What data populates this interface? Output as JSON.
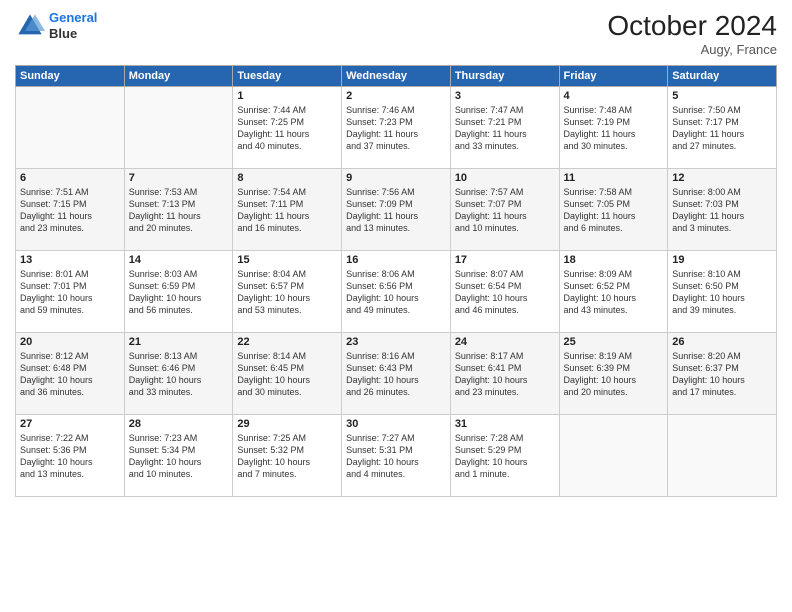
{
  "logo": {
    "line1": "General",
    "line2": "Blue"
  },
  "header": {
    "month": "October 2024",
    "location": "Augy, France"
  },
  "weekdays": [
    "Sunday",
    "Monday",
    "Tuesday",
    "Wednesday",
    "Thursday",
    "Friday",
    "Saturday"
  ],
  "weeks": [
    [
      {
        "day": "",
        "info": ""
      },
      {
        "day": "",
        "info": ""
      },
      {
        "day": "1",
        "info": "Sunrise: 7:44 AM\nSunset: 7:25 PM\nDaylight: 11 hours\nand 40 minutes."
      },
      {
        "day": "2",
        "info": "Sunrise: 7:46 AM\nSunset: 7:23 PM\nDaylight: 11 hours\nand 37 minutes."
      },
      {
        "day": "3",
        "info": "Sunrise: 7:47 AM\nSunset: 7:21 PM\nDaylight: 11 hours\nand 33 minutes."
      },
      {
        "day": "4",
        "info": "Sunrise: 7:48 AM\nSunset: 7:19 PM\nDaylight: 11 hours\nand 30 minutes."
      },
      {
        "day": "5",
        "info": "Sunrise: 7:50 AM\nSunset: 7:17 PM\nDaylight: 11 hours\nand 27 minutes."
      }
    ],
    [
      {
        "day": "6",
        "info": "Sunrise: 7:51 AM\nSunset: 7:15 PM\nDaylight: 11 hours\nand 23 minutes."
      },
      {
        "day": "7",
        "info": "Sunrise: 7:53 AM\nSunset: 7:13 PM\nDaylight: 11 hours\nand 20 minutes."
      },
      {
        "day": "8",
        "info": "Sunrise: 7:54 AM\nSunset: 7:11 PM\nDaylight: 11 hours\nand 16 minutes."
      },
      {
        "day": "9",
        "info": "Sunrise: 7:56 AM\nSunset: 7:09 PM\nDaylight: 11 hours\nand 13 minutes."
      },
      {
        "day": "10",
        "info": "Sunrise: 7:57 AM\nSunset: 7:07 PM\nDaylight: 11 hours\nand 10 minutes."
      },
      {
        "day": "11",
        "info": "Sunrise: 7:58 AM\nSunset: 7:05 PM\nDaylight: 11 hours\nand 6 minutes."
      },
      {
        "day": "12",
        "info": "Sunrise: 8:00 AM\nSunset: 7:03 PM\nDaylight: 11 hours\nand 3 minutes."
      }
    ],
    [
      {
        "day": "13",
        "info": "Sunrise: 8:01 AM\nSunset: 7:01 PM\nDaylight: 10 hours\nand 59 minutes."
      },
      {
        "day": "14",
        "info": "Sunrise: 8:03 AM\nSunset: 6:59 PM\nDaylight: 10 hours\nand 56 minutes."
      },
      {
        "day": "15",
        "info": "Sunrise: 8:04 AM\nSunset: 6:57 PM\nDaylight: 10 hours\nand 53 minutes."
      },
      {
        "day": "16",
        "info": "Sunrise: 8:06 AM\nSunset: 6:56 PM\nDaylight: 10 hours\nand 49 minutes."
      },
      {
        "day": "17",
        "info": "Sunrise: 8:07 AM\nSunset: 6:54 PM\nDaylight: 10 hours\nand 46 minutes."
      },
      {
        "day": "18",
        "info": "Sunrise: 8:09 AM\nSunset: 6:52 PM\nDaylight: 10 hours\nand 43 minutes."
      },
      {
        "day": "19",
        "info": "Sunrise: 8:10 AM\nSunset: 6:50 PM\nDaylight: 10 hours\nand 39 minutes."
      }
    ],
    [
      {
        "day": "20",
        "info": "Sunrise: 8:12 AM\nSunset: 6:48 PM\nDaylight: 10 hours\nand 36 minutes."
      },
      {
        "day": "21",
        "info": "Sunrise: 8:13 AM\nSunset: 6:46 PM\nDaylight: 10 hours\nand 33 minutes."
      },
      {
        "day": "22",
        "info": "Sunrise: 8:14 AM\nSunset: 6:45 PM\nDaylight: 10 hours\nand 30 minutes."
      },
      {
        "day": "23",
        "info": "Sunrise: 8:16 AM\nSunset: 6:43 PM\nDaylight: 10 hours\nand 26 minutes."
      },
      {
        "day": "24",
        "info": "Sunrise: 8:17 AM\nSunset: 6:41 PM\nDaylight: 10 hours\nand 23 minutes."
      },
      {
        "day": "25",
        "info": "Sunrise: 8:19 AM\nSunset: 6:39 PM\nDaylight: 10 hours\nand 20 minutes."
      },
      {
        "day": "26",
        "info": "Sunrise: 8:20 AM\nSunset: 6:37 PM\nDaylight: 10 hours\nand 17 minutes."
      }
    ],
    [
      {
        "day": "27",
        "info": "Sunrise: 7:22 AM\nSunset: 5:36 PM\nDaylight: 10 hours\nand 13 minutes."
      },
      {
        "day": "28",
        "info": "Sunrise: 7:23 AM\nSunset: 5:34 PM\nDaylight: 10 hours\nand 10 minutes."
      },
      {
        "day": "29",
        "info": "Sunrise: 7:25 AM\nSunset: 5:32 PM\nDaylight: 10 hours\nand 7 minutes."
      },
      {
        "day": "30",
        "info": "Sunrise: 7:27 AM\nSunset: 5:31 PM\nDaylight: 10 hours\nand 4 minutes."
      },
      {
        "day": "31",
        "info": "Sunrise: 7:28 AM\nSunset: 5:29 PM\nDaylight: 10 hours\nand 1 minute."
      },
      {
        "day": "",
        "info": ""
      },
      {
        "day": "",
        "info": ""
      }
    ]
  ]
}
